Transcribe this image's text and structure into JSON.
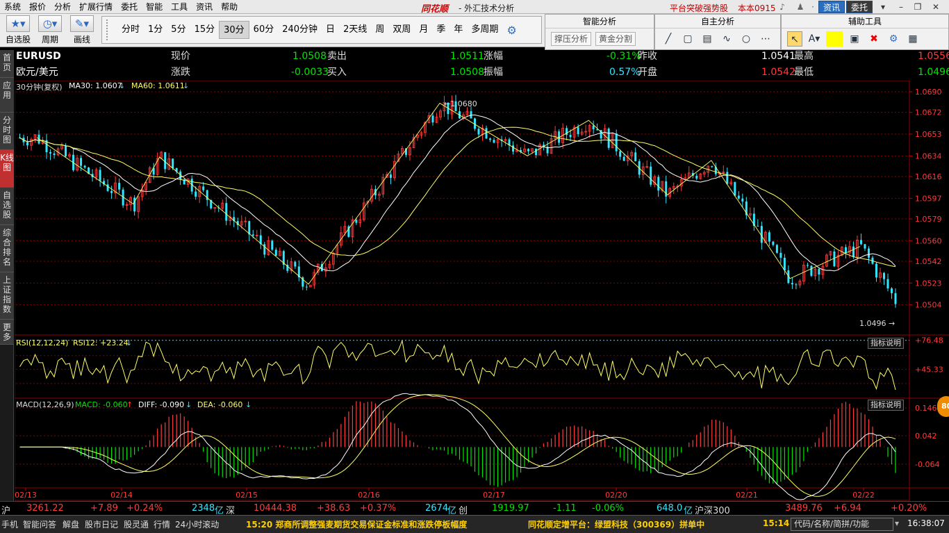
{
  "menu": {
    "items": [
      "系统",
      "报价",
      "分析",
      "扩展行情",
      "委托",
      "智能",
      "工具",
      "资讯",
      "帮助"
    ],
    "brand": "同花顺",
    "window_title": "- 外汇技术分析",
    "promo": "平台突破强势股",
    "version": "本本0915",
    "info_tab": "资讯",
    "trade_tab": "委托"
  },
  "toolbar": {
    "watchlist_label": "自选股",
    "period_label": "周期",
    "draw_label": "画线",
    "periods": [
      "分时",
      "1分",
      "5分",
      "15分",
      "30分",
      "60分",
      "240分钟",
      "日",
      "2天线",
      "周",
      "双周",
      "月",
      "季",
      "年",
      "多周期"
    ],
    "active_period": "30分"
  },
  "smart_panel": {
    "title": "智能分析",
    "support_btn": "撑压分析",
    "gold_btn": "黄金分割"
  },
  "custom_panel": {
    "title": "自主分析"
  },
  "aux_panel": {
    "title": "辅助工具"
  },
  "sidetabs": [
    "首页",
    "应用",
    "分时图",
    "K线图",
    "自选股",
    "综合排名",
    "上证指数",
    "更多"
  ],
  "quote": {
    "symbol": "EURUSD",
    "name": "欧元/美元",
    "current_label": "现价",
    "current": "1.0508",
    "sell_label": "卖出",
    "sell": "1.0511",
    "change_pct_label": "涨幅",
    "change_pct": "-0.31%",
    "prev_close_label": "昨收",
    "prev_close": "1.0541",
    "high_label": "最高",
    "high": "1.0556",
    "change_label": "涨跌",
    "change": "-0.0033",
    "buy_label": "买入",
    "buy": "1.0508",
    "amplitude_label": "振幅",
    "amplitude": "0.57%",
    "open_label": "开盘",
    "open": "1.0542",
    "low_label": "最低",
    "low": "1.0496"
  },
  "chart_labels": {
    "kline_title": "30分钟(复权)",
    "ma30": "MA30: 1.0607",
    "ma60": "MA60: 1.0611",
    "rsi_title": "RSI(12,12,24)",
    "rsi12": "RSI12: +23.24",
    "macd_title": "MACD(12,26,9)",
    "macd": "MACD: -0.060",
    "diff": "DIFF: -0.090",
    "dea": "DEA: -0.060",
    "indicator_help": "指标说明",
    "high_mark": "1.0680",
    "low_mark": "1.0496"
  },
  "chart_data": [
    {
      "type": "candlestick",
      "title": "30分钟(复权)",
      "yticks": [
        "1.0690",
        "1.0672",
        "1.0653",
        "1.0634",
        "1.0616",
        "1.0597",
        "1.0579",
        "1.0560",
        "1.0542",
        "1.0523",
        "1.0504"
      ],
      "ylim": [
        1.0485,
        1.069
      ],
      "xticks": [
        "02/13",
        "02/14",
        "02/15",
        "02/16",
        "02/17",
        "02/20",
        "02/21",
        "02/22"
      ],
      "ma30_last": 1.0607,
      "ma60_last": 1.0611,
      "swing_points": [
        {
          "t": 0.02,
          "v": 1.065
        },
        {
          "t": 0.13,
          "v": 1.0592
        },
        {
          "t": 0.16,
          "v": 1.0633
        },
        {
          "t": 0.33,
          "v": 1.0522
        },
        {
          "t": 0.48,
          "v": 1.068
        },
        {
          "t": 0.58,
          "v": 1.0634
        },
        {
          "t": 0.65,
          "v": 1.0665
        },
        {
          "t": 0.74,
          "v": 1.06
        },
        {
          "t": 0.79,
          "v": 1.063
        },
        {
          "t": 0.88,
          "v": 1.0527
        },
        {
          "t": 0.96,
          "v": 1.0555
        }
      ],
      "range_high": 1.068,
      "range_low": 1.0496
    },
    {
      "type": "line",
      "title": "RSI(12,12,24)",
      "yticks": [
        "+76.48",
        "+45.33"
      ],
      "last": 23.24
    },
    {
      "type": "bar",
      "title": "MACD(12,26,9)",
      "yticks": [
        "0.146",
        "0.042",
        "-0.064"
      ],
      "macd_last": -0.06,
      "diff_last": -0.09,
      "dea_last": -0.06
    }
  ],
  "indexbar": {
    "sh_label": "沪",
    "sh_value": "3261.22",
    "sh_change": "+7.89",
    "sh_pct": "+0.24%",
    "sh_turnover": "2348",
    "yi": "亿",
    "sz_label": "深",
    "sz_value": "10444.38",
    "sz_change": "+38.63",
    "sz_pct": "+0.37%",
    "sz_turnover": "2674",
    "cy_label": "创",
    "cy_value": "1919.97",
    "cy_change": "-1.11",
    "cy_pct": "-0.06%",
    "cy_turnover": "648.0",
    "hs300_label": "沪深300",
    "hs300_value": "3489.76",
    "hs300_change": "+6.94",
    "hs300_pct": "+0.20%"
  },
  "statusbar": {
    "items": [
      "手机",
      "智能问答",
      "解盘",
      "股市日记",
      "股灵通",
      "行情",
      "24小时滚动"
    ],
    "ticker1": "15:20 郑商所调整强麦期货交易保证金标准和涨跌停板幅度",
    "ticker2": "同花顺定增平台：绿盟科技（300369）拼单中",
    "time1": "15:14",
    "search_box": "代码/名称/简拼/功能",
    "clock": "16:38:07"
  },
  "badge": "80",
  "colors": {
    "up": "#ff3c3c",
    "down": "#33e6ff",
    "ma_white": "#ffffff",
    "ma_yellow": "#ffff66",
    "grid_red": "#8b0000"
  }
}
